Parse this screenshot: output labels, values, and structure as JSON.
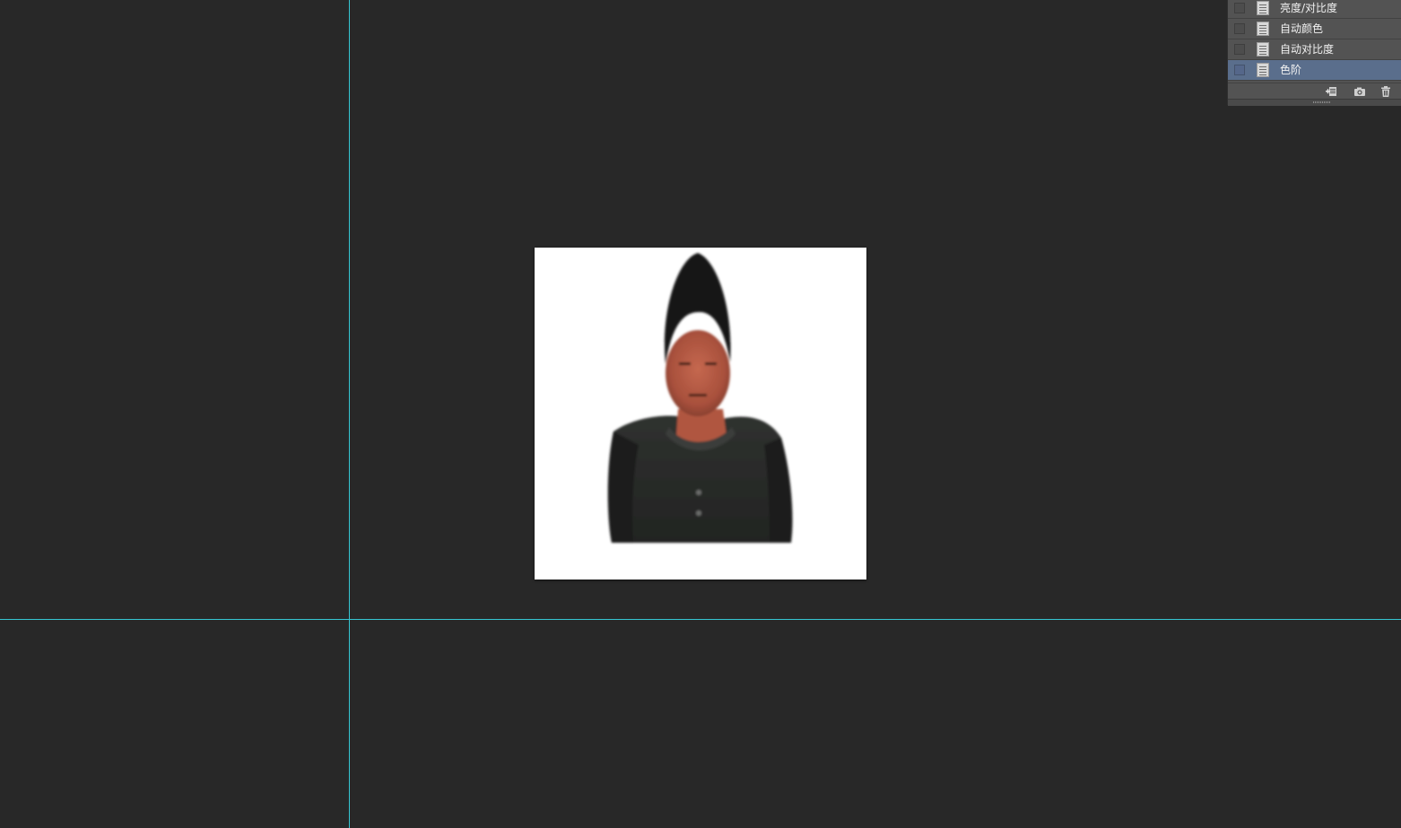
{
  "history_panel": {
    "items": [
      {
        "label": "亮度/对比度",
        "icon": "history-state-icon",
        "selected": false
      },
      {
        "label": "自动颜色",
        "icon": "history-state-icon",
        "selected": false
      },
      {
        "label": "自动对比度",
        "icon": "history-state-icon",
        "selected": false
      },
      {
        "label": "色阶",
        "icon": "history-state-icon",
        "selected": true
      }
    ],
    "footer_buttons": [
      "new-document-from-state-icon",
      "camera-icon",
      "trash-icon"
    ]
  },
  "colors": {
    "workspace_bg": "#282828",
    "guide_color": "#35c6d3",
    "panel_bg": "#535353",
    "selected_row": "#5a6e8c"
  }
}
